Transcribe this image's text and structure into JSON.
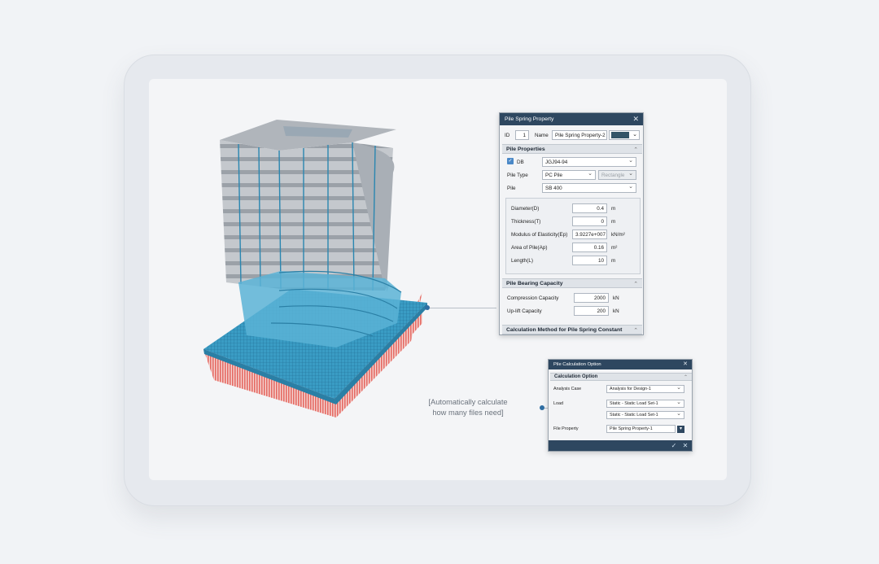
{
  "pile_spring_property": {
    "title": "Pile Spring Property",
    "id_label": "ID",
    "id_value": "1",
    "name_label": "Name",
    "name_value": "Pile Spring Property-2",
    "swatch_color": "#345568",
    "pile_properties": {
      "header": "Pile Properties",
      "db_label": "DB",
      "db_value": "JGJ94-94",
      "pile_type_label": "Pile Type",
      "pile_type_value": "PC Pile",
      "pile_shape_value": "Rectangle",
      "pile_label": "Pile",
      "pile_value": "SB 400",
      "params": [
        {
          "label": "Diameter(D)",
          "value": "0.4",
          "unit": "m"
        },
        {
          "label": "Thickness(T)",
          "value": "0",
          "unit": "m"
        },
        {
          "label": "Modulus of Elasticity(Ep)",
          "value": "3.9227e+007",
          "unit": "kN/m²"
        },
        {
          "label": "Area of Pile(Ap)",
          "value": "0.16",
          "unit": "m²"
        },
        {
          "label": "Length(L)",
          "value": "10",
          "unit": "m"
        }
      ]
    },
    "bearing_capacity": {
      "header": "Pile Bearing Capacity",
      "compression_label": "Compression Capacity",
      "compression_value": "2000",
      "compression_unit": "kN",
      "uplift_label": "Up-lift Capacity",
      "uplift_value": "200",
      "uplift_unit": "kN"
    },
    "calc_method_header": "Calculation Method for Pile Spring Constant"
  },
  "pile_calculation_option": {
    "title": "Pile Calculation Option",
    "section_header": "Calculation Option",
    "analysis_case_label": "Analysis Case",
    "analysis_case_value": "Analysis for Design-1",
    "load_label": "Load",
    "load_value_1": "Static - Static Load Set-1",
    "load_value_2": "Static - Static Load Set-1",
    "file_property_label": "File Property",
    "file_property_value": "Pile Spring Property-1"
  },
  "annotation": {
    "line1": "[Automatically calculate",
    "line2": "how many files need]"
  },
  "colors": {
    "accent_dark": "#2e4760",
    "foundation_blue": "#3a9cc4",
    "piles_red": "#e56a63",
    "building_gray": "#b9bec4"
  }
}
